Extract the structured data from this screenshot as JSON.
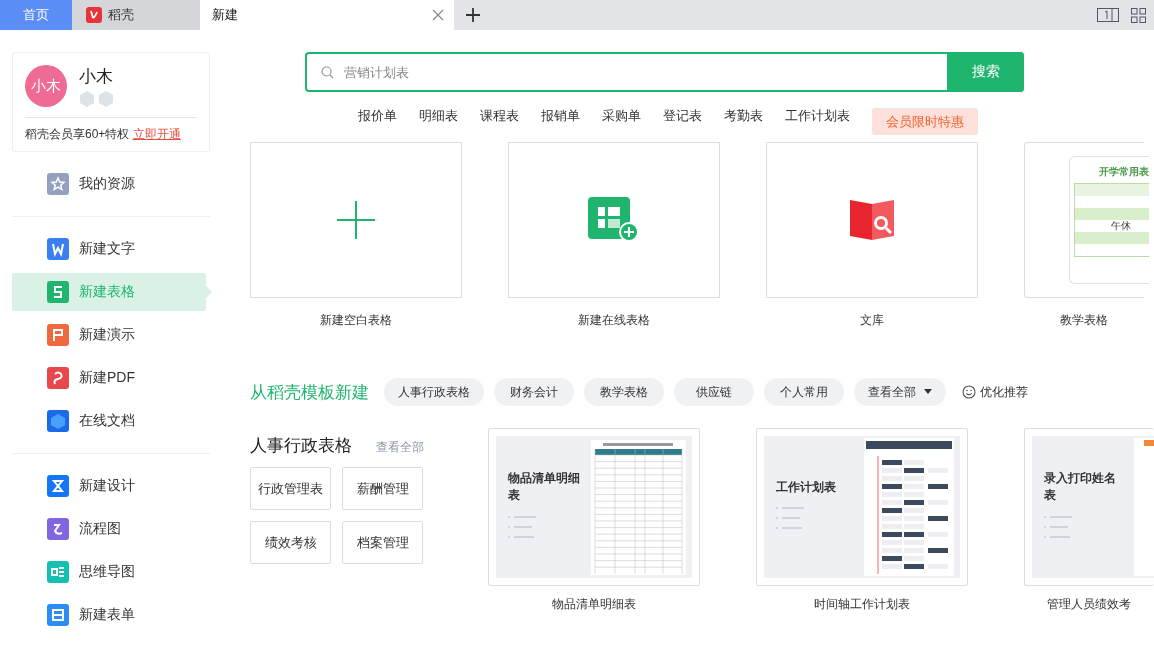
{
  "tabs": [
    {
      "label": "首页",
      "kind": "home",
      "selected": false
    },
    {
      "label": "稻壳",
      "kind": "docer",
      "selected": false
    },
    {
      "label": "新建",
      "kind": "doc",
      "selected": true
    }
  ],
  "user": {
    "avatar_text": "小木",
    "name": "小木",
    "promo": "稻壳会员享60+特权",
    "promo_link": "立即开通"
  },
  "sidebar": {
    "groups": [
      [
        {
          "label": "我的资源",
          "kind": "star",
          "color": "#94a0c0",
          "selected": false
        }
      ],
      [
        {
          "label": "新建文字",
          "kind": "writer",
          "color": "#3a7ff0",
          "selected": false
        },
        {
          "label": "新建表格",
          "kind": "sheet",
          "color": "#1fb56e",
          "selected": true
        },
        {
          "label": "新建演示",
          "kind": "slides",
          "color": "#ee6a3e",
          "selected": false
        },
        {
          "label": "新建PDF",
          "kind": "pdf",
          "color": "#e8484b",
          "selected": false
        },
        {
          "label": "在线文档",
          "kind": "cloud",
          "color": "#1d6ae8",
          "selected": false
        }
      ],
      [
        {
          "label": "新建设计",
          "kind": "design",
          "color": "#1677f5",
          "selected": false
        },
        {
          "label": "流程图",
          "kind": "flow",
          "color": "#8266e0",
          "selected": false
        },
        {
          "label": "思维导图",
          "kind": "mind",
          "color": "#14c0b0",
          "selected": false
        },
        {
          "label": "新建表单",
          "kind": "form",
          "color": "#2a8ef5",
          "selected": false
        }
      ]
    ]
  },
  "search": {
    "placeholder": "营销计划表",
    "button": "搜索"
  },
  "hot_tags": [
    {
      "label": "报价单",
      "kind": "tag"
    },
    {
      "label": "明细表",
      "kind": "tag"
    },
    {
      "label": "课程表",
      "kind": "tag"
    },
    {
      "label": "报销单",
      "kind": "tag"
    },
    {
      "label": "采购单",
      "kind": "tag"
    },
    {
      "label": "登记表",
      "kind": "tag"
    },
    {
      "label": "考勤表",
      "kind": "tag"
    },
    {
      "label": "工作计划表",
      "kind": "tag"
    },
    {
      "label": "会员限时特惠",
      "kind": "promo"
    }
  ],
  "quick_cards": [
    {
      "label": "新建空白表格",
      "kind": "blank"
    },
    {
      "label": "新建在线表格",
      "kind": "online"
    },
    {
      "label": "文库",
      "kind": "library"
    },
    {
      "label": "教学表格",
      "kind": "preview",
      "preview_title": "开学常用表",
      "preview_cell": "午休"
    }
  ],
  "categories": {
    "title": "从稻壳模板新建",
    "chips": [
      {
        "label": "人事行政表格",
        "kind": "chip"
      },
      {
        "label": "财务会计",
        "kind": "chip"
      },
      {
        "label": "教学表格",
        "kind": "chip"
      },
      {
        "label": "供应链",
        "kind": "chip"
      },
      {
        "label": "个人常用",
        "kind": "chip"
      },
      {
        "label": "查看全部",
        "kind": "dropdown"
      }
    ],
    "recommend": "优化推荐"
  },
  "section": {
    "title": "人事行政表格",
    "view_all": "查看全部",
    "links": [
      "行政管理表",
      "薪酬管理",
      "绩效考核",
      "档案管理"
    ],
    "templates": [
      {
        "title": "物品清单明细表",
        "preview_title": "物品清单明细表",
        "kind": "list"
      },
      {
        "title": "时间轴工作计划表",
        "preview_title": "工作计划表",
        "kind": "timeline"
      },
      {
        "title": "管理人员绩效考",
        "preview_title": "录入打印姓名表",
        "kind": "form"
      }
    ]
  }
}
